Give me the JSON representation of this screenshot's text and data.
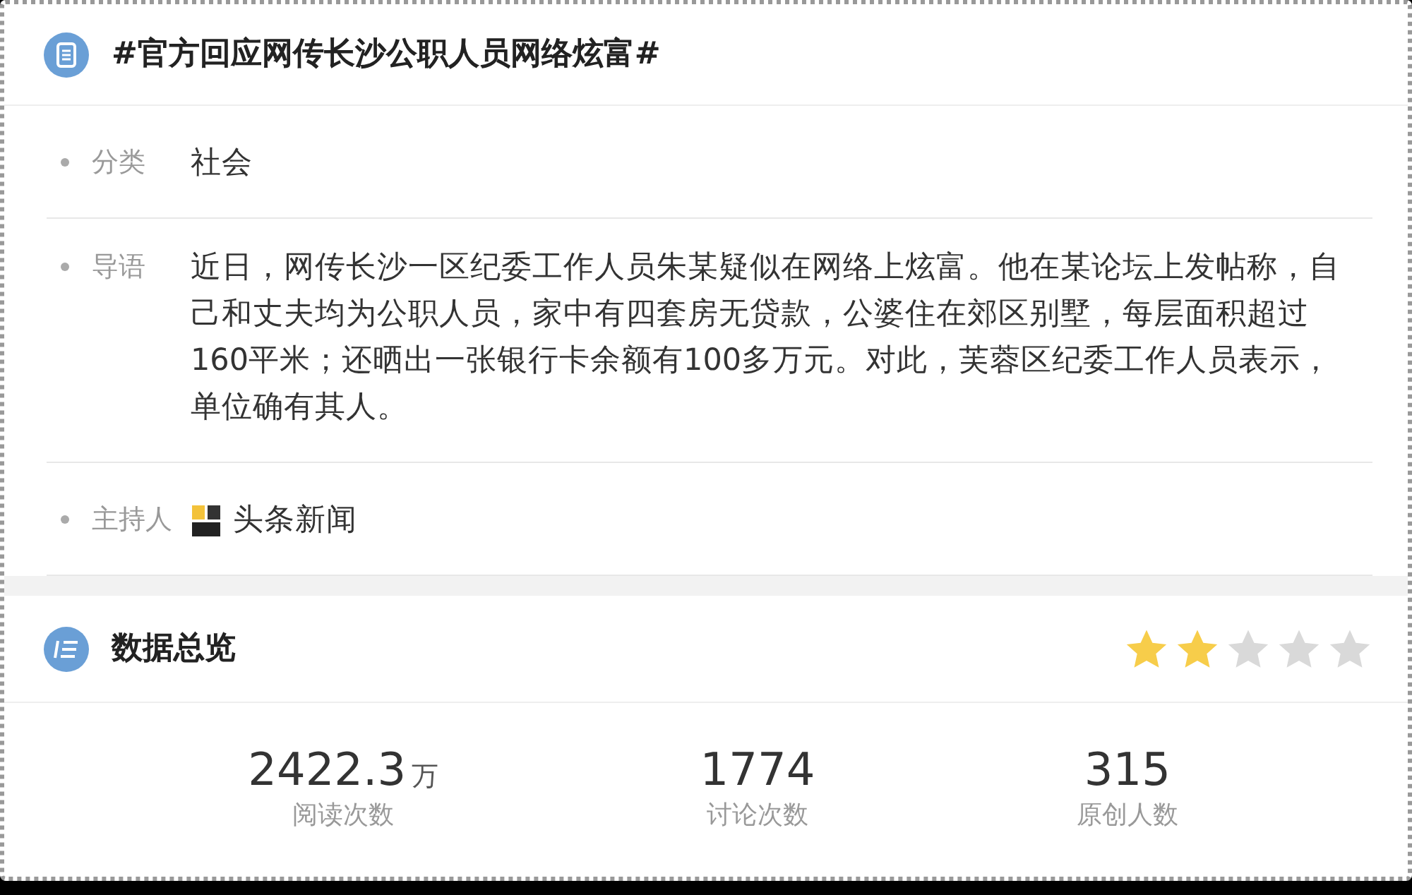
{
  "topic": {
    "title": "#官方回应网传长沙公职人员网络炫富#"
  },
  "fields": [
    {
      "label": "分类",
      "value": "社会",
      "kind": "text"
    },
    {
      "label": "导语",
      "value": "近日，网传长沙一区纪委工作人员朱某疑似在网络上炫富。他在某论坛上发帖称，自己和丈夫均为公职人员，家中有四套房无贷款，公婆住在郊区别墅，每层面积超过160平米；还晒出一张银行卡余额有100多万元。对此，芙蓉区纪委工作人员表示，单位确有其人。",
      "kind": "text"
    },
    {
      "label": "主持人",
      "value": "头条新闻",
      "kind": "host"
    }
  ],
  "overview": {
    "title": "数据总览",
    "stars": 2,
    "stats": [
      {
        "value": "2422.3",
        "unit": "万",
        "label": "阅读次数"
      },
      {
        "value": "1774",
        "label": "讨论次数"
      },
      {
        "value": "315",
        "label": "原创人数"
      }
    ]
  }
}
